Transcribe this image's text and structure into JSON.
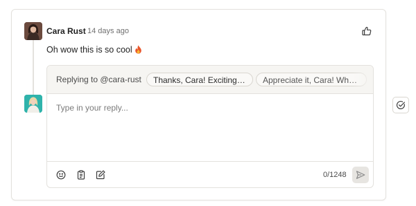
{
  "comment": {
    "author": "Cara Rust",
    "time": "14 days ago",
    "text": "Oh wow this is so cool",
    "emoji_icon": "flame-icon",
    "like_icon": "thumbs-up-icon"
  },
  "reply": {
    "replying_to": "Replying to @cara-rust",
    "suggestions": [
      "Thanks, Cara! Exciting, r...",
      "Appreciate it, Cara! What..."
    ],
    "placeholder": "Type in your reply...",
    "value": "",
    "counter": "0/1248",
    "tools": [
      "emoji-icon",
      "clipboard-icon",
      "edit-icon"
    ],
    "send_icon": "send-icon"
  },
  "side_action_icon": "check-circle-icon",
  "colors": {
    "accent_avatar": "#2fb3ab",
    "border": "#e3e1dd",
    "flame": "#e8552a"
  }
}
